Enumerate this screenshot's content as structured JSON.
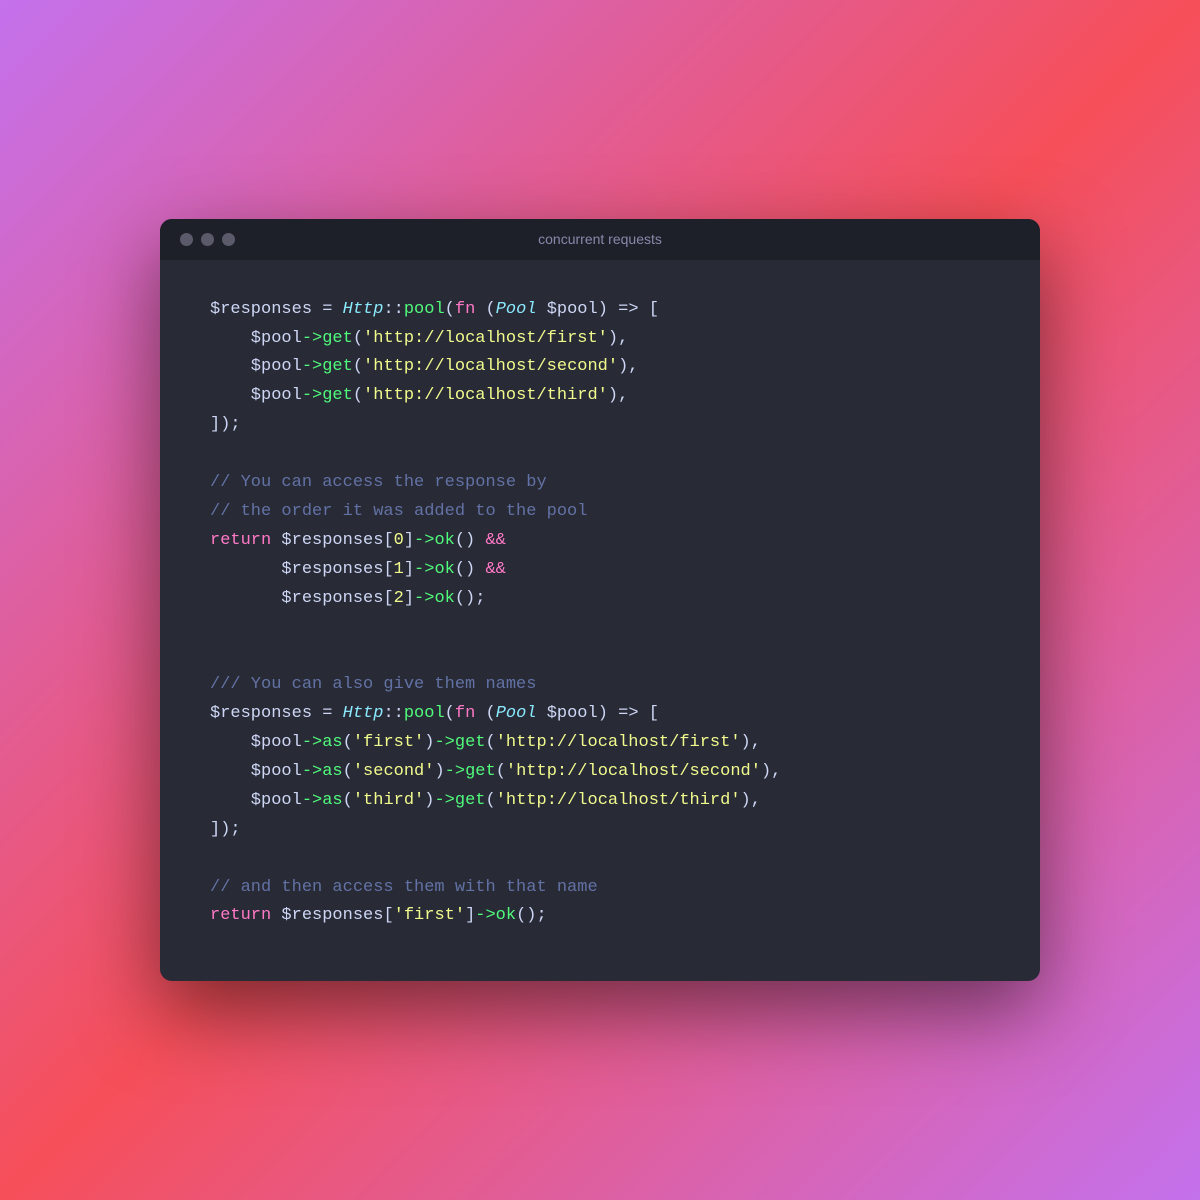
{
  "window": {
    "title": "concurrent requests"
  },
  "code": {
    "sections": [
      {
        "id": "section1",
        "lines": [
          "$responses = Http::pool(fn (Pool $pool) => [",
          "    $pool->get('http://localhost/first'),",
          "    $pool->get('http://localhost/second'),",
          "    $pool->get('http://localhost/third'),",
          "]);"
        ]
      },
      {
        "id": "section2",
        "comment_lines": [
          "// You can access the response by",
          "// the order it was added to the pool"
        ],
        "lines": [
          "return $responses[0]->ok() &&",
          "       $responses[1]->ok() &&",
          "       $responses[2]->ok();"
        ]
      },
      {
        "id": "section3",
        "comment_line": "/// You can also give them names",
        "lines": [
          "$responses = Http::pool(fn (Pool $pool) => [",
          "    $pool->as('first')->get('http://localhost/first'),",
          "    $pool->as('second')->get('http://localhost/second'),",
          "    $pool->as('third')->get('http://localhost/third'),",
          "]);"
        ]
      },
      {
        "id": "section4",
        "comment_line": "// and then access them with that name",
        "lines": [
          "return $responses['first']->ok();"
        ]
      }
    ]
  }
}
